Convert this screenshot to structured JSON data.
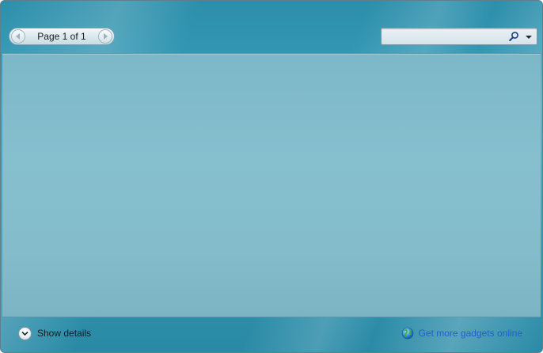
{
  "toolbar": {
    "pager": {
      "label": "Page 1 of 1"
    },
    "search": {
      "value": "",
      "placeholder": ""
    }
  },
  "footer": {
    "show_details_label": "Show details",
    "get_gadgets_label": "Get more gadgets online"
  },
  "icons": {
    "prev": "chevron-left-icon",
    "next": "chevron-right-icon",
    "search": "search-icon",
    "dropdown": "chevron-down-icon",
    "details": "chevron-down-icon",
    "globe": "globe-icon"
  },
  "colors": {
    "frame": "#2c8eaa",
    "content": "#84bccb",
    "link": "#1f5fd1"
  }
}
